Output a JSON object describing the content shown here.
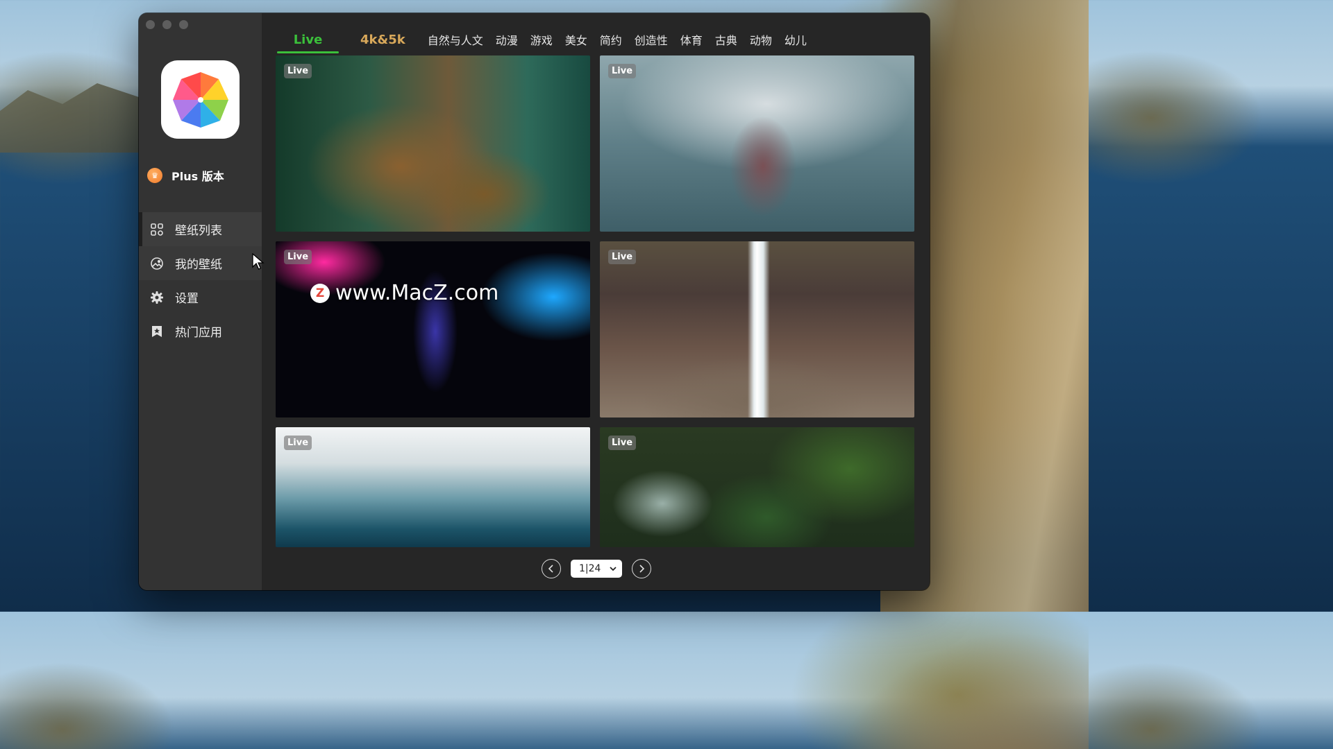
{
  "window": {
    "sidebar": {
      "plus_label": "Plus 版本",
      "nav": [
        {
          "label": "壁纸列表",
          "icon": "grid-icon"
        },
        {
          "label": "我的壁纸",
          "icon": "image-icon"
        },
        {
          "label": "设置",
          "icon": "gear-icon"
        },
        {
          "label": "热门应用",
          "icon": "bookmark-star-icon"
        }
      ]
    },
    "tabs": [
      "Live",
      "4k&5k",
      "自然与人文",
      "动漫",
      "游戏",
      "美女",
      "简约",
      "创造性",
      "体育",
      "古典",
      "动物",
      "幼儿"
    ],
    "active_tab": "Live",
    "cards": [
      {
        "badge": "Live"
      },
      {
        "badge": "Live"
      },
      {
        "badge": "Live"
      },
      {
        "badge": "Live"
      },
      {
        "badge": "Live"
      },
      {
        "badge": "Live"
      }
    ],
    "pager": {
      "current": "1|24"
    },
    "watermark": {
      "logo_letter": "Z",
      "text": "www.MacZ.com"
    }
  },
  "colors": {
    "accent_live": "#3bc03b",
    "accent_4k": "#d8a85a",
    "plus_badge": "#f07a2a"
  }
}
